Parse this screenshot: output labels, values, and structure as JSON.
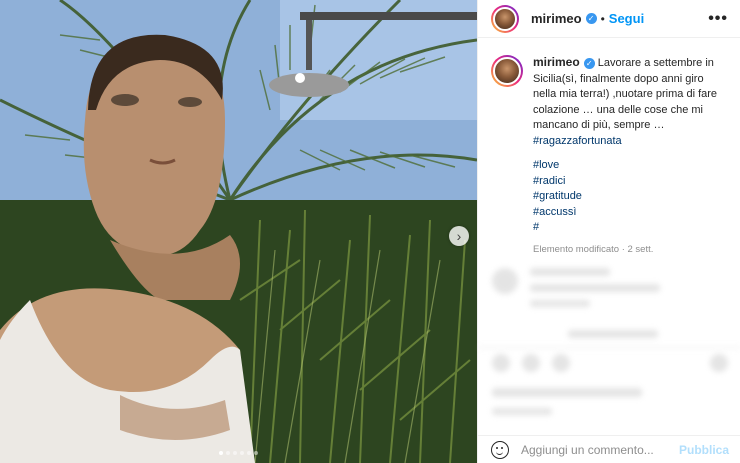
{
  "post": {
    "username": "mirimeo",
    "follow_label": "Segui",
    "more_label": "•••",
    "next_label": "›"
  },
  "caption": {
    "username": "mirimeo",
    "text": " Lavorare a settembre in Sicilia(sì, finalmente dopo anni giro nella mia terra!) ,nuotare prima di fare colazione … una delle cose che mi mancano di più, sempre …",
    "hashtag_main": "#ragazzafortunata",
    "hashtags": [
      "#love",
      "#radici",
      "#gratitude",
      "#accussì",
      "#"
    ],
    "meta": "Elemento modificato · 2 sett."
  },
  "footer": {
    "comment_placeholder": "Aggiungi un commento...",
    "publish_label": "Pubblica"
  },
  "carousel": {
    "count": 6,
    "active_index": 0
  },
  "colors": {
    "link": "#0095f6",
    "hashtag": "#00376b",
    "verified": "#3897f0"
  },
  "icons": {
    "verified": "verified-badge-icon",
    "emoji": "emoji-icon",
    "next": "chevron-right-icon",
    "more": "more-icon"
  }
}
